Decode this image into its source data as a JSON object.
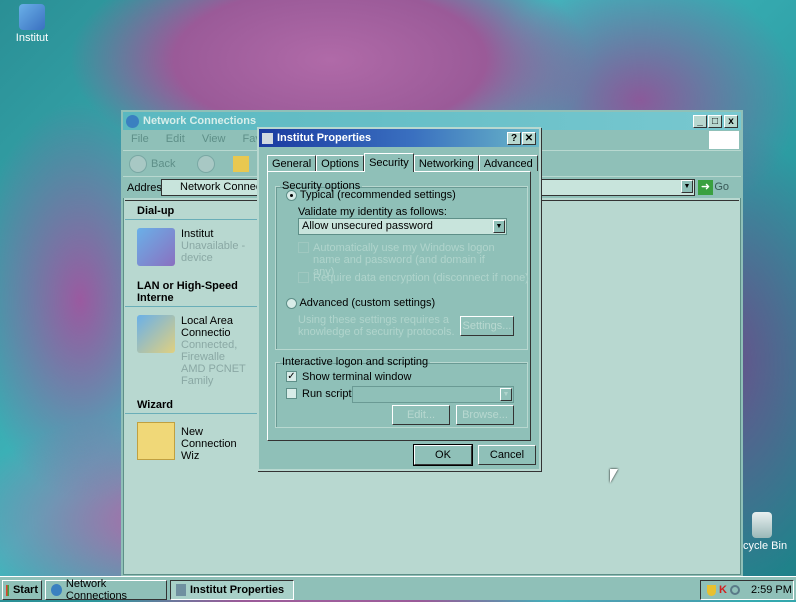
{
  "desktop": {
    "icons": [
      {
        "label": "Institut"
      },
      {
        "label": "ecycle Bin"
      }
    ]
  },
  "explorer": {
    "title": "Network Connections",
    "menu": [
      "File",
      "Edit",
      "View",
      "Favorites"
    ],
    "toolbar": {
      "back": "Back"
    },
    "address": {
      "label": "Address",
      "value": "Network Connections",
      "go": "Go"
    },
    "sections": [
      {
        "title": "Dial-up",
        "items": [
          {
            "name": "Institut",
            "lines": [
              "Unavailable - device"
            ]
          }
        ]
      },
      {
        "title": "LAN or High-Speed Interne",
        "items": [
          {
            "name": "Local Area Connectio",
            "lines": [
              "Connected, Firewalle",
              "AMD PCNET Family"
            ]
          }
        ]
      },
      {
        "title": "Wizard",
        "items": [
          {
            "name": "New Connection Wiz",
            "lines": []
          }
        ]
      }
    ]
  },
  "dialog": {
    "title": "Institut Properties",
    "help": "?",
    "close": "✕",
    "tabs": [
      "General",
      "Options",
      "Security",
      "Networking",
      "Advanced"
    ],
    "active_tab": "Security",
    "security_options": {
      "legend": "Security options",
      "typical": "Typical (recommended settings)",
      "typical_selected": true,
      "validate_label": "Validate my identity as follows:",
      "validate_value": "Allow unsecured password",
      "auto_logon": "Automatically use my Windows logon name and password (and domain if any)",
      "require_encryption": "Require data encryption (disconnect if none)",
      "advanced": "Advanced (custom settings)",
      "advanced_desc": "Using these settings requires a knowledge of security protocols.",
      "settings_btn": "Settings..."
    },
    "interactive": {
      "legend": "Interactive logon and scripting",
      "show_terminal": "Show terminal window",
      "show_terminal_checked": true,
      "run_script": "Run script:",
      "run_script_checked": false,
      "edit_btn": "Edit...",
      "browse_btn": "Browse..."
    },
    "ok": "OK",
    "cancel": "Cancel"
  },
  "taskbar": {
    "start": "Start",
    "tasks": [
      {
        "label": "Network Connections",
        "active": false
      },
      {
        "label": "Institut Properties",
        "active": true
      }
    ],
    "clock": "2:59 PM"
  }
}
